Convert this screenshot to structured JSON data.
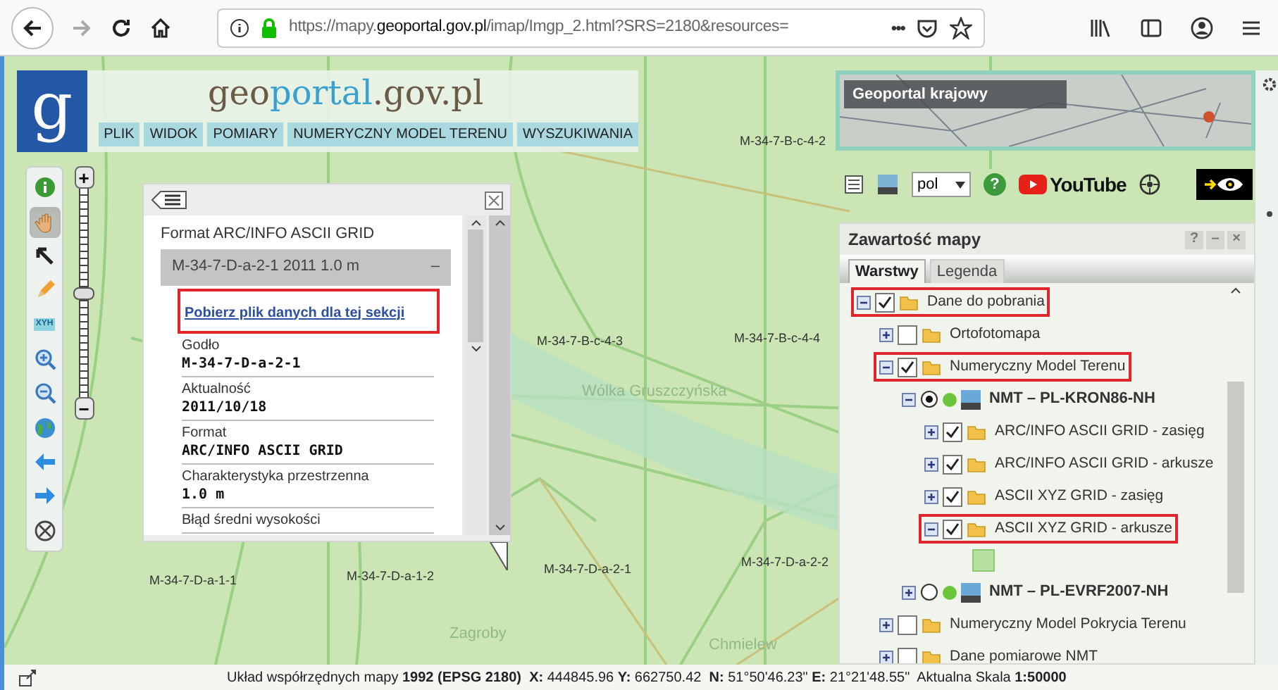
{
  "browser": {
    "url_prefix": "https://mapy.",
    "url_domain": "geoportal.gov.pl",
    "url_rest": "/imap/Imgp_2.html?SRS=2180&resources=",
    "forward_disabled": true,
    "more": "•••"
  },
  "header": {
    "logo_letter": "g",
    "site_name_parts": [
      "geo",
      "portal",
      ".gov.pl"
    ],
    "menu": [
      "PLIK",
      "WIDOK",
      "POMIARY",
      "NUMERYCZNY MODEL TERENU",
      "WYSZUKIWANIA"
    ]
  },
  "overview_map": {
    "title": "Geoportal krajowy"
  },
  "toolbar": {
    "language": "pol",
    "help": "?",
    "video_site": "YouTube"
  },
  "map_tools": [
    {
      "kind": "info",
      "selected": false
    },
    {
      "kind": "pan",
      "selected": true
    },
    {
      "kind": "select",
      "selected": false
    },
    {
      "kind": "draw",
      "selected": false
    },
    {
      "kind": "coordinates",
      "label": "XYH",
      "selected": false
    },
    {
      "kind": "zoom_in",
      "selected": false
    },
    {
      "kind": "zoom_out",
      "selected": false
    },
    {
      "kind": "full_extent",
      "selected": false
    },
    {
      "kind": "back",
      "selected": false
    },
    {
      "kind": "forward",
      "selected": false
    },
    {
      "kind": "center",
      "selected": false
    }
  ],
  "zoom_slider": {
    "level": 0.5,
    "plus": "+",
    "minus": "−"
  },
  "map_labels": [
    {
      "text": "M-34-7-B-c-4-2",
      "kind": "sheet"
    },
    {
      "text": "M-34-7-B-c-4-3",
      "kind": "sheet"
    },
    {
      "text": "M-34-7-B-c-4-4",
      "kind": "sheet"
    },
    {
      "text": "M-34-7-D-a-1-1",
      "kind": "sheet"
    },
    {
      "text": "M-34-7-D-a-1-2",
      "kind": "sheet"
    },
    {
      "text": "M-34-7-D-a-2-1",
      "kind": "sheet"
    },
    {
      "text": "M-34-7-D-a-2-2",
      "kind": "sheet"
    },
    {
      "text": "Wólka Gruszczyńska",
      "kind": "place"
    },
    {
      "text": "Zagroby",
      "kind": "place"
    },
    {
      "text": "Chmielew",
      "kind": "place"
    }
  ],
  "info_popup": {
    "title": "Format ARC/INFO ASCII GRID",
    "section": {
      "title": "M-34-7-D-a-2-1 2011 1.0 m",
      "symbol": "–"
    },
    "link": {
      "text": "Pobierz plik danych dla tej sekcji",
      "highlighted": true
    },
    "fields": [
      {
        "label": "Godło",
        "value": "M-34-7-D-a-2-1"
      },
      {
        "label": "Aktualność",
        "value": "2011/10/18"
      },
      {
        "label": "Format",
        "value": "ARC/INFO ASCII GRID"
      },
      {
        "label": "Charakterystyka przestrzenna",
        "value": "1.0 m"
      },
      {
        "label": "Błąd średni wysokości"
      }
    ]
  },
  "layers_panel": {
    "title": "Zawartość mapy",
    "buttons": [
      "?",
      "–",
      "×"
    ],
    "tabs": [
      {
        "label": "Warstwy",
        "selected": true
      },
      {
        "label": "Legenda",
        "selected": false
      }
    ],
    "items": [
      {
        "kind": "folder",
        "label": "Dane do pobrania",
        "checked": true,
        "expanded": true,
        "highlighted": true,
        "children": [
          {
            "kind": "folder",
            "label": "Ortofotomapa",
            "checked": false,
            "expanded": false,
            "highlighted": false
          },
          {
            "kind": "folder",
            "label": "Numeryczny Model Terenu",
            "checked": true,
            "expanded": true,
            "highlighted": true,
            "children": [
              {
                "kind": "service",
                "label": "NMT – PL-KRON86-NH",
                "selected": true,
                "expanded": true,
                "highlighted": false,
                "children": [
                  {
                    "kind": "folder",
                    "label": "ARC/INFO ASCII GRID - zasięg",
                    "checked": true,
                    "expanded": false,
                    "highlighted": false
                  },
                  {
                    "kind": "folder",
                    "label": "ARC/INFO ASCII GRID - arkusze",
                    "checked": true,
                    "expanded": false,
                    "highlighted": false
                  },
                  {
                    "kind": "folder",
                    "label": "ASCII XYZ GRID - zasięg",
                    "checked": true,
                    "expanded": false,
                    "highlighted": false
                  },
                  {
                    "kind": "folder",
                    "label": "ASCII XYZ GRID - arkusze",
                    "checked": true,
                    "expanded": true,
                    "highlighted": true
                  }
                ]
              },
              {
                "kind": "service",
                "label": "NMT – PL-EVRF2007-NH",
                "selected": false,
                "expanded": false,
                "highlighted": false
              }
            ]
          },
          {
            "kind": "folder",
            "label": "Numeryczny Model Pokrycia Terenu",
            "checked": false,
            "expanded": false,
            "highlighted": false
          },
          {
            "kind": "folder",
            "label": "Dane pomiarowe NMT",
            "checked": false,
            "expanded": false,
            "highlighted": false
          }
        ]
      }
    ]
  },
  "status_bar": {
    "text": "Układ współrzędnych mapy **1992 (EPSG 2180)**  **X:** 444845.96 **Y:** 662750.42  **N:** 51°50'46.23\" **E:** 21°21'48.55\"  Aktualna Skala **1:50000**"
  }
}
